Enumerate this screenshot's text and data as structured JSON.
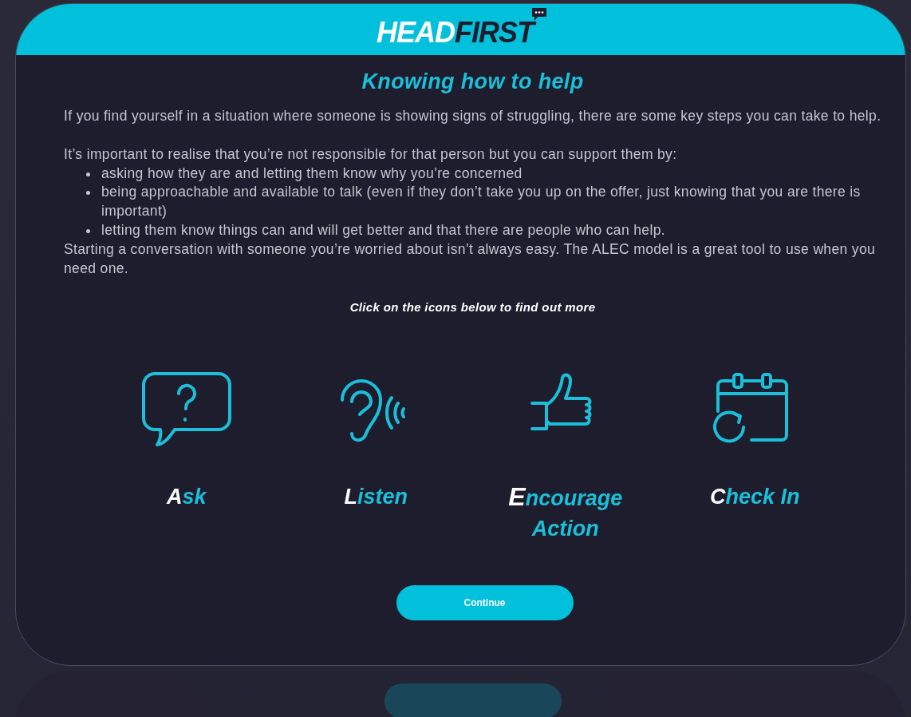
{
  "logo": {
    "text_light": "HEAD",
    "text_dark": "FIRST"
  },
  "title": "Knowing how to help",
  "paragraphs": [
    "If you find yourself in a situation where someone is showing signs of struggling, there are some key steps you can take to help.",
    "It’s important to realise that you’re not responsible for that person but you can support them by:"
  ],
  "bullets": [
    "asking how they are and letting them know why you’re concerned",
    "being approachable and available to talk (even if they don’t take you up on the offer, just knowing that you are there is important)",
    "letting them know things can and will get better and that there are people who can help."
  ],
  "closing": "Starting a conversation with someone you’re worried about isn’t always easy. The ALEC model is a great tool to use when you need one.",
  "instruction": "Click on the icons below to find out more",
  "steps": [
    {
      "kind": "ask",
      "label": "Ask"
    },
    {
      "kind": "listen",
      "label": "Listen"
    },
    {
      "kind": "encourage",
      "label": "Encourage Action"
    },
    {
      "kind": "checkin",
      "label": "Check In"
    }
  ],
  "continue_button": "Continue"
}
